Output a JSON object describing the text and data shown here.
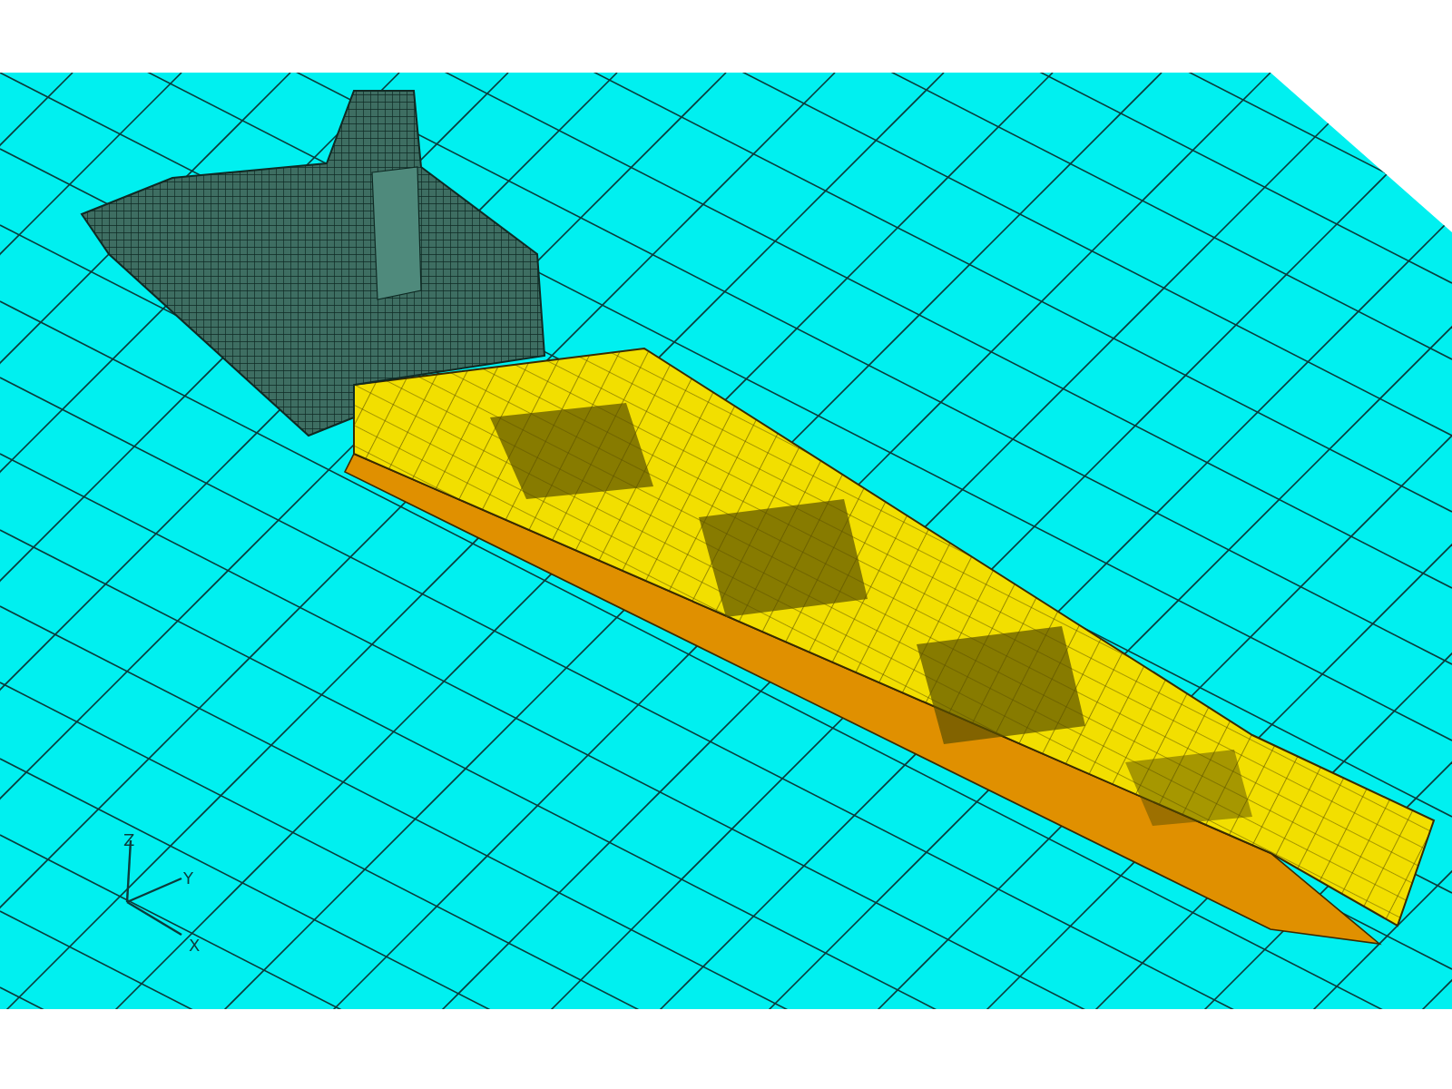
{
  "triad": {
    "axes": [
      {
        "label": "Z"
      },
      {
        "label": "Y"
      },
      {
        "label": "X"
      }
    ]
  }
}
